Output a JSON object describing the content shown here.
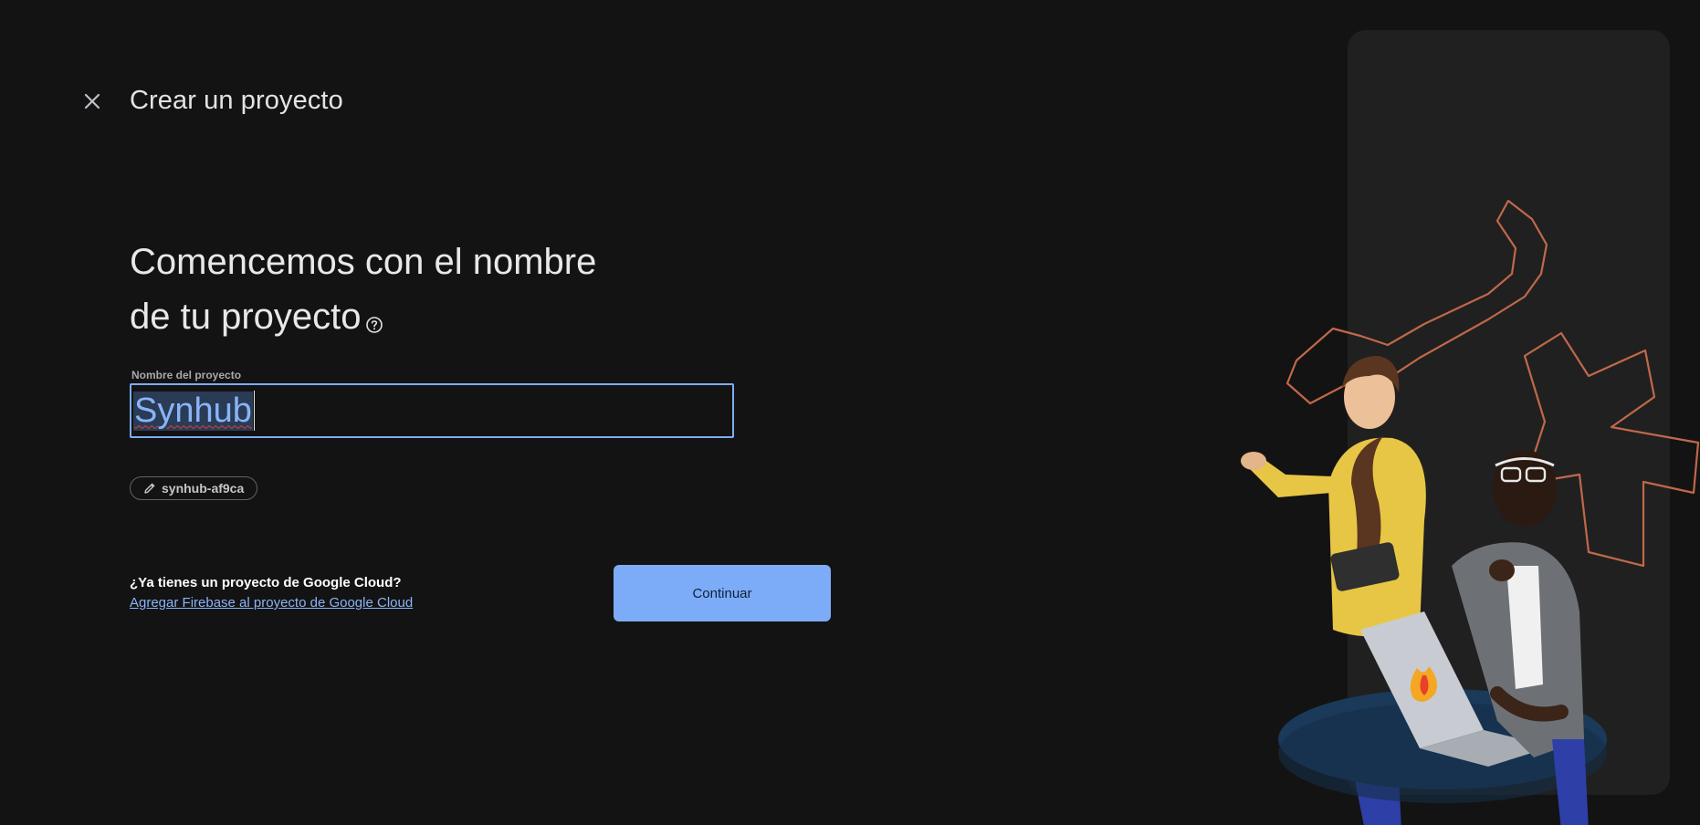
{
  "header": {
    "title": "Crear un proyecto"
  },
  "main": {
    "heading_line1": "Comencemos con el nombre",
    "heading_line2": "de tu proyecto",
    "project_name": {
      "label": "Nombre del proyecto",
      "value": "Synhub"
    },
    "project_id": "synhub-af9ca",
    "google_cloud": {
      "question": "¿Ya tienes un proyecto de Google Cloud?",
      "link": "Agregar Firebase al proyecto de Google Cloud"
    },
    "continue_label": "Continuar"
  },
  "colors": {
    "background": "#131313",
    "accent": "#7cacf8",
    "link": "#8ab4f8",
    "illustration_outline": "#c0684a"
  },
  "icons": {
    "close": "close-icon",
    "help": "help-circle-icon",
    "edit": "pencil-icon"
  }
}
